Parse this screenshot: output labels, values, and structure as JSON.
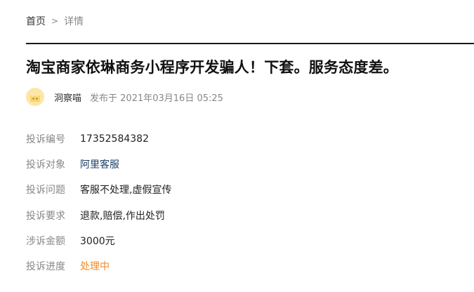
{
  "breadcrumb": {
    "home": "首页",
    "separator": ">",
    "current": "详情"
  },
  "complaint": {
    "title": "淘宝商家依琳商务小程序开发骗人！下套。服务态度差。"
  },
  "author": {
    "avatar_icon": "cat-avatar-icon",
    "name": "洞察喵",
    "published": "发布于 2021年03月16日 05:25"
  },
  "info": {
    "number_label": "投诉编号",
    "number_value": "17352584382",
    "target_label": "投诉对象",
    "target_value": "阿里客服",
    "issue_label": "投诉问题",
    "issue_value": "客服不处理,虚假宣传",
    "demand_label": "投诉要求",
    "demand_value": "退款,赔偿,作出处罚",
    "amount_label": "涉诉金额",
    "amount_value": "3000元",
    "progress_label": "投诉进度",
    "progress_value": "处理中"
  },
  "colors": {
    "status_orange": "#f08a24",
    "link_blue": "#1f3f66",
    "avatar_yellow": "#fde7a8"
  }
}
